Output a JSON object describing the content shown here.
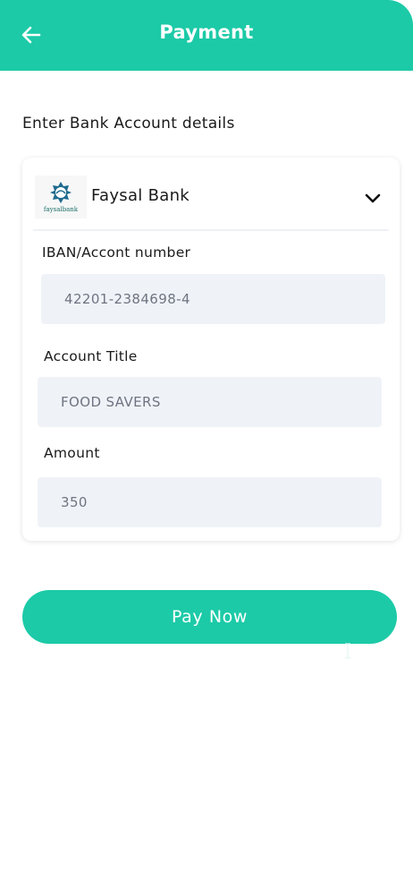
{
  "header": {
    "title": "Payment",
    "back_icon": "arrow-left-icon",
    "color": "#1ccaa7"
  },
  "form": {
    "section_label": "Enter Bank Account details",
    "bank": {
      "name": "Faysal Bank",
      "logo_text": "faysalbank",
      "dropdown_icon": "chevron-down-icon"
    },
    "fields": {
      "iban": {
        "label": "IBAN/Accont number",
        "value": "42201-2384698-4"
      },
      "title": {
        "label": "Account Title",
        "value": "FOOD SAVERS"
      },
      "amount": {
        "label": "Amount",
        "value": "350"
      }
    }
  },
  "pay_button": {
    "label": "Pay Now"
  },
  "colors": {
    "accent": "#1ccaa7",
    "input_bg": "#eff3f8",
    "text": "#1a1a1a",
    "input_text": "#6e7480"
  }
}
